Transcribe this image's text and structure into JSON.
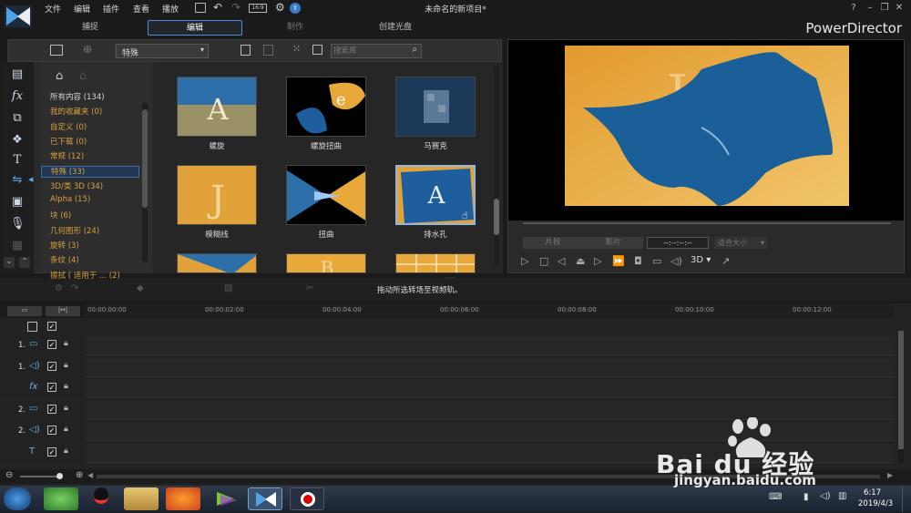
{
  "window": {
    "title": "未命名的新项目*",
    "brand": "PowerDirector"
  },
  "menu": [
    "文件",
    "编辑",
    "插件",
    "查看",
    "播放"
  ],
  "tabs": [
    {
      "label": "捕捉",
      "active": false
    },
    {
      "label": "编辑",
      "active": true
    },
    {
      "label": "制作",
      "active": false
    },
    {
      "label": "创建光盘",
      "active": false
    }
  ],
  "library": {
    "filter_value": "特殊",
    "search_placeholder": "搜索库",
    "categories": [
      {
        "label": "所有内容 (134)",
        "white": true
      },
      {
        "label": "我的收藏夹  (0)"
      },
      {
        "label": "自定义  (0)"
      },
      {
        "label": "已下载  (0)"
      },
      {
        "label": "常规  (12)"
      },
      {
        "label": "特殊  (33)",
        "selected": true
      },
      {
        "label": "3D/类 3D  (34)"
      },
      {
        "label": "Alpha  (15)"
      },
      {
        "label": "块  (6)"
      },
      {
        "label": "几何图形  (24)"
      },
      {
        "label": "旋转  (3)"
      },
      {
        "label": "条纹  (4)"
      },
      {
        "label": "擦拭 ( 适用于 ...  (2)"
      }
    ],
    "transitions": [
      {
        "label": "螺旋"
      },
      {
        "label": "螺旋扭曲"
      },
      {
        "label": "马赛克"
      },
      {
        "label": "模糊线"
      },
      {
        "label": "扭曲"
      },
      {
        "label": "排水孔"
      }
    ]
  },
  "preview": {
    "btn_clip": "片段",
    "btn_movie": "影片",
    "timecode": "--:--:--:--",
    "zoom": "适合大小",
    "mode_3d": "3D"
  },
  "timeline": {
    "hint": "拖动所选转场至视频轨。",
    "ticks": [
      "00:00:00:00",
      "00:00:02:00",
      "00:00:04:00",
      "00:00:06:00",
      "00:00:08:00",
      "00:00:10:00",
      "00:00:12:00"
    ],
    "tracks": [
      {
        "label": "1.",
        "icon": "video-track-icon"
      },
      {
        "label": "1.",
        "icon": "audio-track-icon"
      },
      {
        "label": "",
        "icon": "fx-track-icon"
      },
      {
        "label": "2.",
        "icon": "video-track-icon"
      },
      {
        "label": "2.",
        "icon": "audio-track-icon"
      },
      {
        "label": "",
        "icon": "title-track-icon"
      }
    ]
  },
  "taskbar": {
    "time": "6:17",
    "date": "2019/4/3"
  },
  "watermark": {
    "brand": "Bai du 经验",
    "url": "jingyan.baidu.com"
  }
}
